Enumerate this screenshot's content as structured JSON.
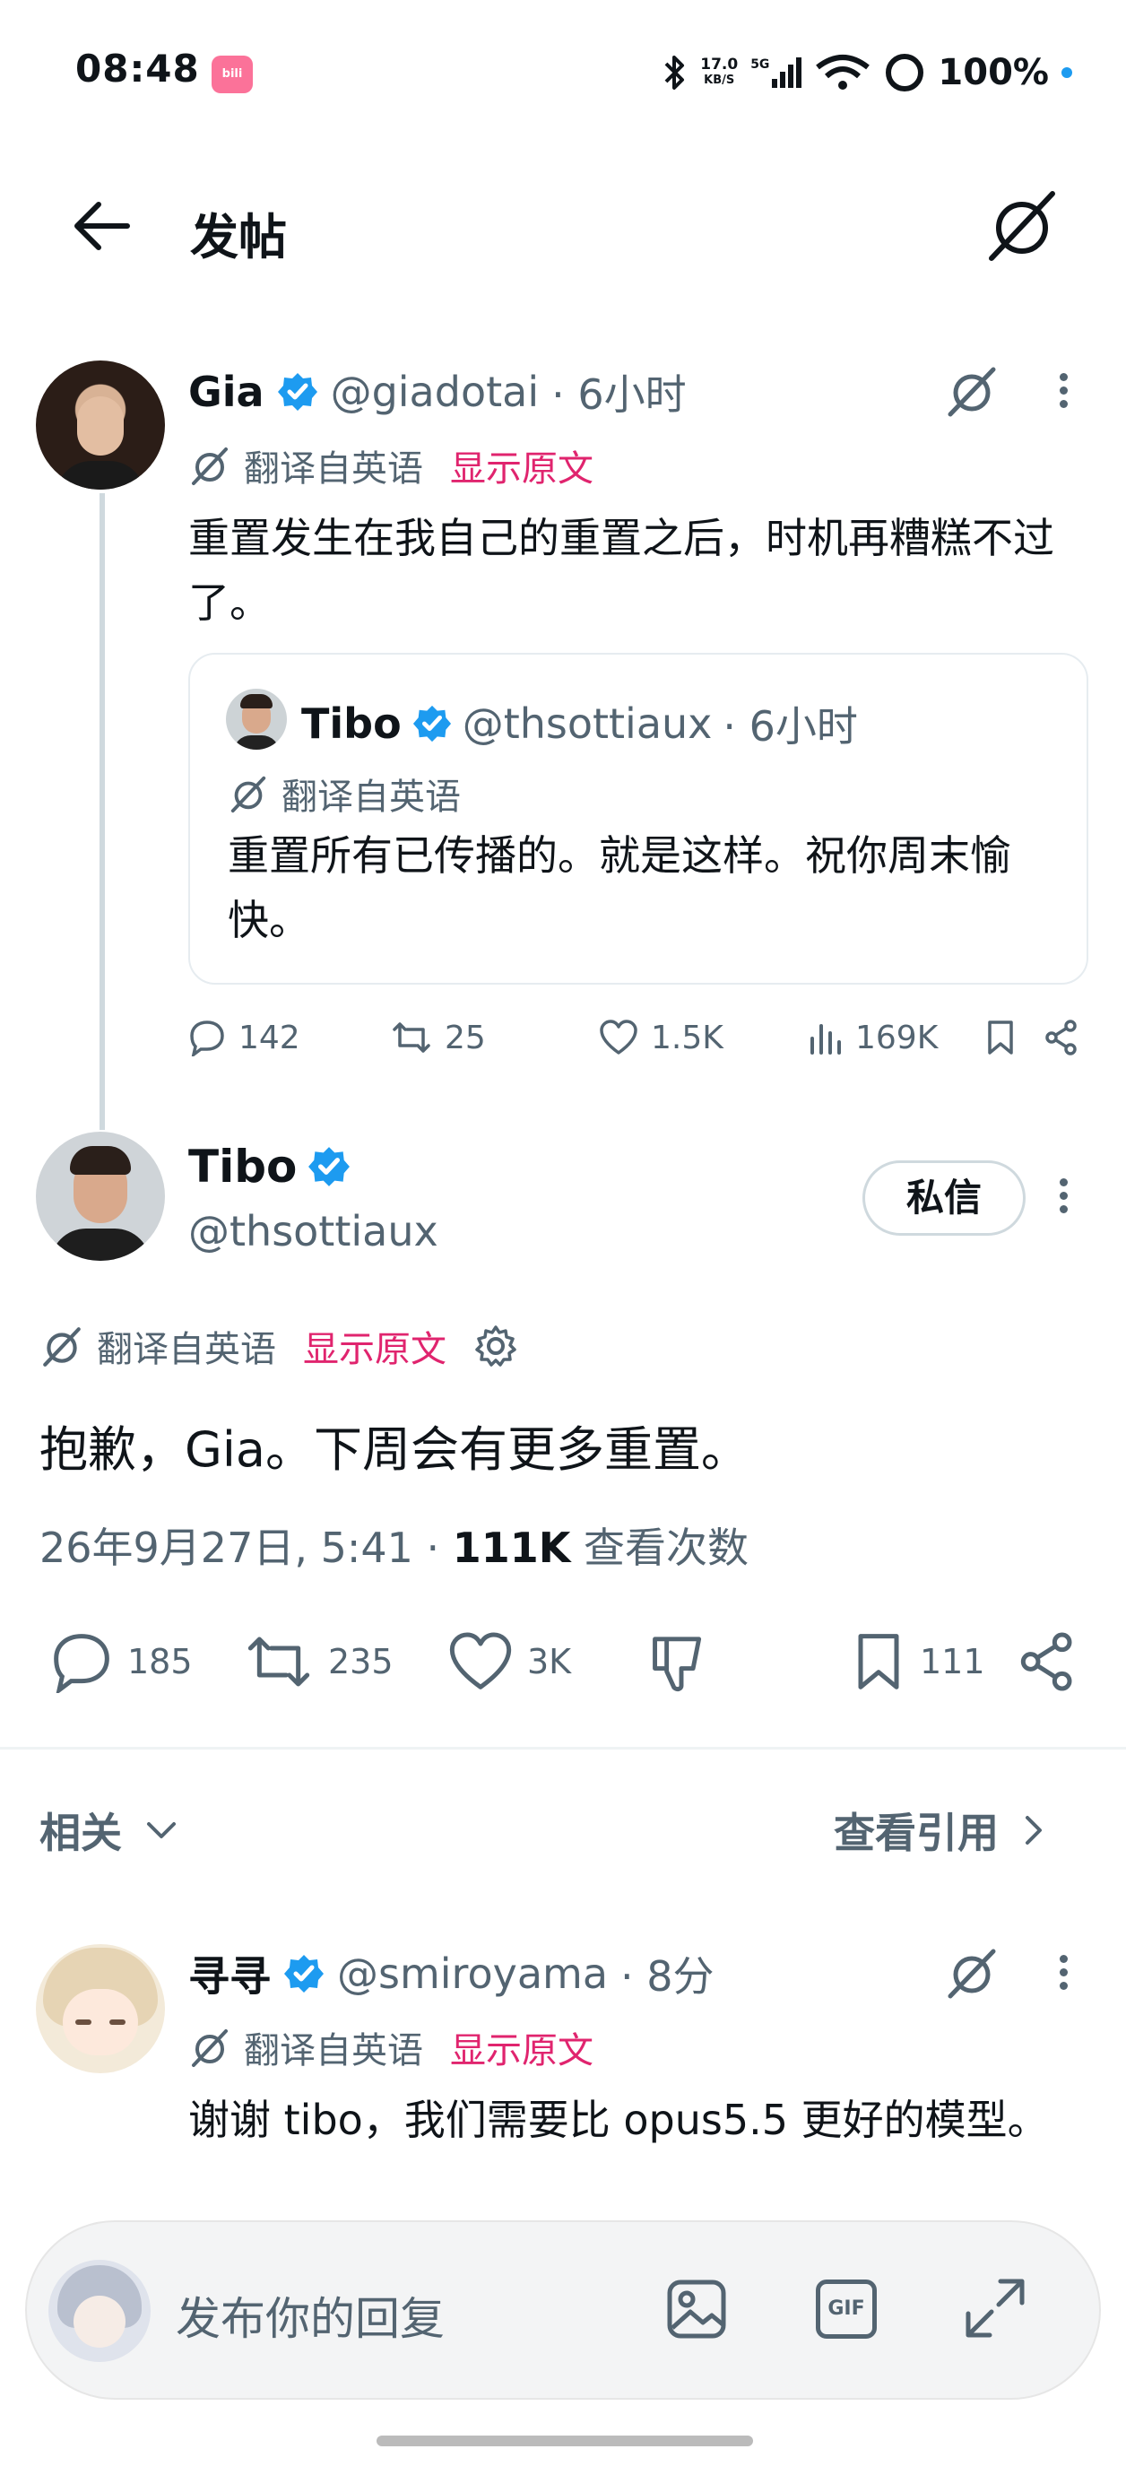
{
  "status_bar": {
    "time": "08:48",
    "app_badge": "bilibili",
    "net_speed": "17.0",
    "net_unit": "KB/S",
    "signal_label": "5G",
    "battery": "100%"
  },
  "header": {
    "title": "发帖"
  },
  "parent_post": {
    "name": "Gia",
    "handle": "@giadotai",
    "time": "· 6小时",
    "translated_label": "翻译自英语",
    "show_original": "显示原文",
    "text": "重置发生在我自己的重置之后，时机再糟糕不过了。",
    "quote": {
      "name": "Tibo",
      "handle": "@thsottiaux",
      "time": "· 6小时",
      "translated_label": "翻译自英语",
      "text": "重置所有已传播的。就是这样。祝你周末愉快。"
    },
    "metrics": {
      "replies": "142",
      "reposts": "25",
      "likes": "1.5K",
      "views": "169K"
    }
  },
  "main_post": {
    "name": "Tibo",
    "handle": "@thsottiaux",
    "dm_button": "私信",
    "translated_label": "翻译自英语",
    "show_original": "显示原文",
    "text": "抱歉，Gia。下周会有更多重置。",
    "date": "26年9月27日, 5:41 ·",
    "views_count": "111K",
    "views_label": "查看次数",
    "metrics": {
      "replies": "185",
      "reposts": "235",
      "likes": "3K",
      "bookmarks": "111"
    }
  },
  "related": {
    "label": "相关",
    "view_quotes": "查看引用"
  },
  "reply_post": {
    "name": "寻寻",
    "handle": "@smiroyama",
    "time": "· 8分",
    "translated_label": "翻译自英语",
    "show_original": "显示原文",
    "text": "谢谢 tibo，我们需要比 opus5.5 更好的模型。"
  },
  "composer": {
    "placeholder": "发布你的回复",
    "gif_label": "GIF"
  },
  "colors": {
    "accent_blue": "#1d9bf0",
    "link_pink": "#e0246e",
    "secondary_text": "#536471"
  }
}
